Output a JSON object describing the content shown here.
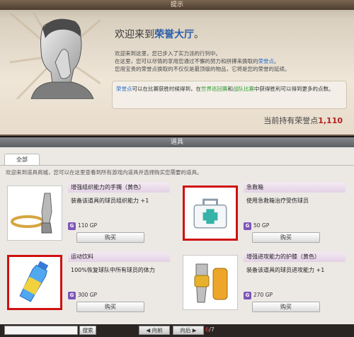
{
  "notice": {
    "title": "提示",
    "welcome_prefix": "欢迎来到",
    "welcome_highlight": "荣誉大厅",
    "welcome_suffix": "。",
    "intro_line1": "欢迎来到这里，您已步入了实力派的行列中。",
    "intro_line2a": "在这里，您可以尽情的享用您通过不懈的努力和拼搏来换取的",
    "intro_line2b": "荣誉点",
    "intro_line2c": "。",
    "intro_line3": "您用宝贵的荣誉点换取的不仅仅是最顶级的物品，它将是您的荣誉的延续。",
    "info_a": "荣誉点",
    "info_b": "可以在比赛获胜时候得到，在",
    "info_c": "世界巡回赛",
    "info_d": "和",
    "info_e": "战队比赛",
    "info_f": "中获得胜利可以得到更多的点数。",
    "points_label": "当前持有荣誉点",
    "points_value": "1,110"
  },
  "shop": {
    "title": "道具",
    "tab_all": "全部",
    "description": "欢迎来到道具商城，您可以在这里查看到所有游戏内道具并选择购买您需要的道具。",
    "buy_label": "购买",
    "currency_icon": "G",
    "items": [
      {
        "name": "增强组织能力的手镯（黄色）",
        "desc": "装备该道具的球员组织能力 +1",
        "price": "110 GP",
        "icon": "bracelet-icon",
        "highlighted": false
      },
      {
        "name": "急救箱",
        "desc": "使用急救箱治疗受伤球员",
        "price": "50 GP",
        "icon": "first-aid-kit-icon",
        "highlighted": true
      },
      {
        "name": "运动饮料",
        "desc": "100%恢复球队中所有球员的体力",
        "price": "300 GP",
        "icon": "sports-drink-icon",
        "highlighted": true
      },
      {
        "name": "增强进攻能力的护膝（黄色）",
        "desc": "装备该道具的球员进攻能力 +1",
        "price": "270 GP",
        "icon": "knee-pad-icon",
        "highlighted": false
      }
    ]
  },
  "bottom": {
    "search_placeholder": "",
    "search_label": "搜索",
    "prev_label": "◀ 向前",
    "next_label": "向后 ▶",
    "page_current": "6",
    "page_total": "/7"
  },
  "colors": {
    "highlight_border": "#d01010",
    "gp_badge": "#7e55b8",
    "points_value": "#b32222"
  }
}
